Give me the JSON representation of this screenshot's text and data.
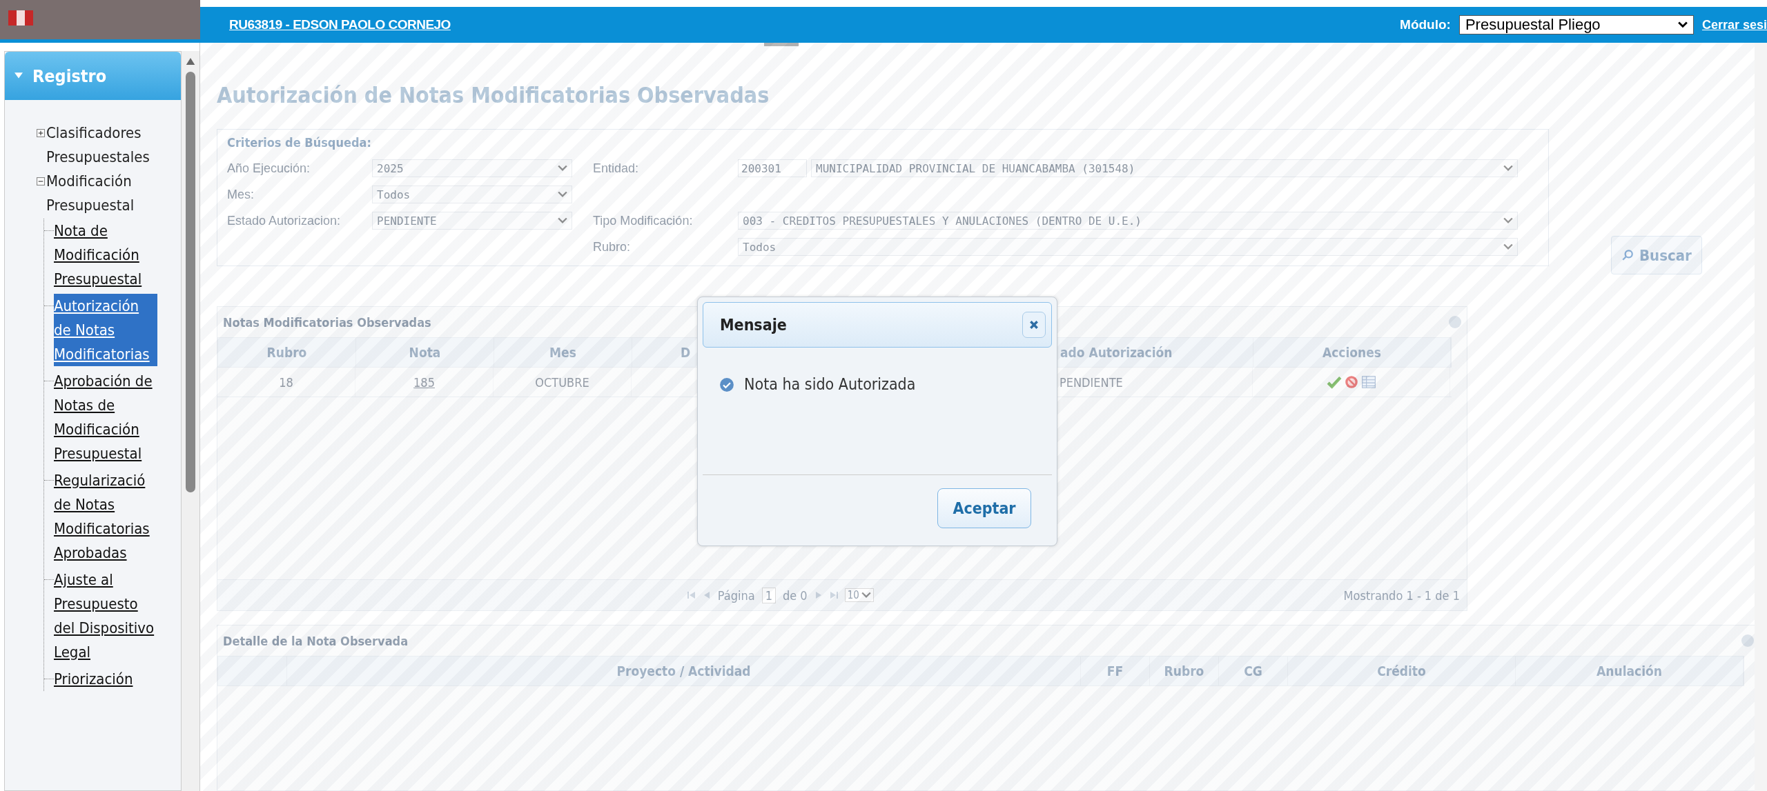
{
  "header": {
    "user": "RU63819  - EDSON PAOLO CORNEJO",
    "module_label": "Módulo:",
    "module_value": "Presupuestal Pliego",
    "logout": "Cerrar sesi"
  },
  "sidebar": {
    "section": {
      "label": "Registro",
      "expanded": true
    },
    "tree": [
      {
        "label": "Clasificadores Presupuestales",
        "expanded": false
      },
      {
        "label": "Modificación Presupuestal",
        "expanded": true,
        "children": [
          {
            "label": "Nota de Modificación Presupuestal",
            "selected": false
          },
          {
            "label": "Autorización de Notas Modificatorias",
            "selected": true
          },
          {
            "label": "Aprobación de Notas de Modificación Presupuestal",
            "selected": false
          },
          {
            "label": "Regularizació de Notas Modificatorias Aprobadas",
            "selected": false
          },
          {
            "label": "Ajuste al Presupuesto del Dispositivo Legal",
            "selected": false
          },
          {
            "label": "Priorización",
            "selected": false
          }
        ]
      }
    ]
  },
  "page_title": "Autorización de Notas Modificatorias Observadas",
  "criteria": {
    "title": "Criterios de Búsqueda:",
    "fields": [
      {
        "label": "Año Ejecución:",
        "value": "2025"
      },
      {
        "label": "Entidad:",
        "code": "200301",
        "value": "MUNICIPALIDAD PROVINCIAL DE HUANCABAMBA (301548)"
      },
      {
        "label": "Mes:",
        "value": "Todos"
      },
      {
        "label": "Estado Autorizacion:",
        "value": "PENDIENTE"
      },
      {
        "label": "Tipo Modificación:",
        "value": "003 - CREDITOS PRESUPUESTALES Y ANULACIONES (DENTRO DE U.E.)"
      },
      {
        "label": "Rubro:",
        "value": "Todos"
      }
    ],
    "search_button": "Buscar"
  },
  "notes_table": {
    "title": "Notas Modificatorias Observadas",
    "columns": [
      "Rubro",
      "Nota",
      "Mes",
      "D",
      "ado Autorización",
      "Acciones"
    ],
    "rows": [
      {
        "rubro": "18",
        "nota": "185",
        "mes": "OCTUBRE",
        "estado": "PENDIENTE"
      }
    ],
    "pager": {
      "page_label": "Página",
      "page": "1",
      "of": "de 0",
      "page_size": "10",
      "summary": "Mostrando 1 - 1 de 1"
    }
  },
  "detail_table": {
    "title": "Detalle de la Nota Observada",
    "columns": [
      "Proyecto / Actividad",
      "FF",
      "Rubro",
      "CG",
      "Crédito",
      "Anulación"
    ]
  },
  "dialog": {
    "title": "Mensaje",
    "message": "Nota ha sido Autorizada",
    "button": "Aceptar"
  }
}
